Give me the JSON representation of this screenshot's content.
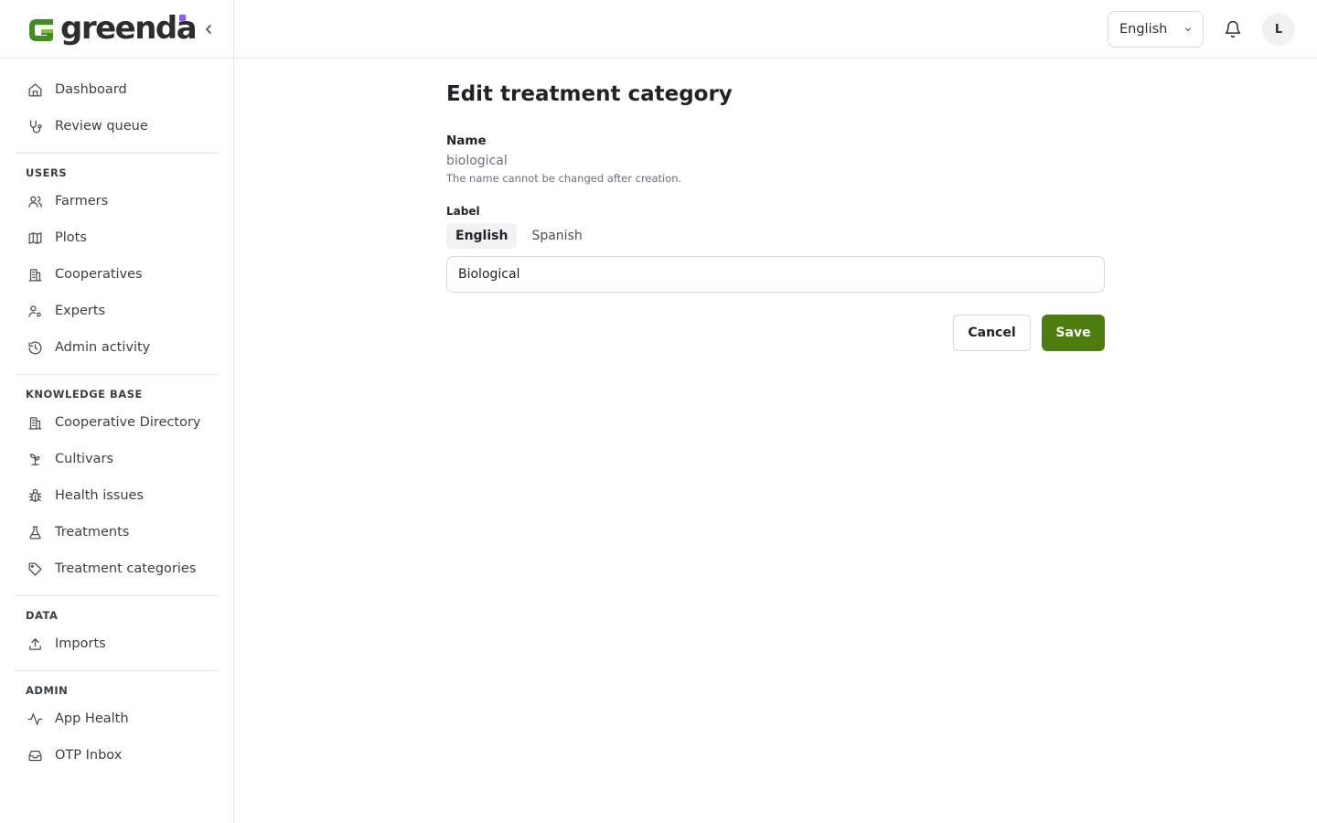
{
  "brand": {
    "name": "greenda",
    "accent": "#8b5cf6",
    "logo_green": "#3f8f1f"
  },
  "sidebar": {
    "main": [
      {
        "label": "Dashboard",
        "icon": "home-icon"
      },
      {
        "label": "Review queue",
        "icon": "stethoscope-icon"
      }
    ],
    "users_title": "USERS",
    "users": [
      {
        "label": "Farmers",
        "icon": "users-icon"
      },
      {
        "label": "Plots",
        "icon": "map-icon"
      },
      {
        "label": "Cooperatives",
        "icon": "building-icon"
      },
      {
        "label": "Experts",
        "icon": "user-cog-icon"
      },
      {
        "label": "Admin activity",
        "icon": "history-icon"
      }
    ],
    "kb_title": "KNOWLEDGE BASE",
    "kb": [
      {
        "label": "Cooperative Directory",
        "icon": "building-icon"
      },
      {
        "label": "Cultivars",
        "icon": "sprout-icon"
      },
      {
        "label": "Health issues",
        "icon": "bug-icon"
      },
      {
        "label": "Treatments",
        "icon": "flask-icon"
      },
      {
        "label": "Treatment categories",
        "icon": "tag-icon"
      }
    ],
    "data_title": "DATA",
    "data": [
      {
        "label": "Imports",
        "icon": "upload-icon"
      }
    ],
    "admin_title": "ADMIN",
    "admin": [
      {
        "label": "App Health",
        "icon": "activity-icon"
      },
      {
        "label": "OTP Inbox",
        "icon": "inbox-icon"
      }
    ]
  },
  "header": {
    "language": "English",
    "avatar_initial": "L"
  },
  "form": {
    "title": "Edit treatment category",
    "name_label": "Name",
    "name_value": "biological",
    "name_help": "The name cannot be changed after creation.",
    "label_label": "Label",
    "tabs": [
      {
        "label": "English",
        "active": true
      },
      {
        "label": "Spanish",
        "active": false
      }
    ],
    "label_value": "Biological",
    "cancel_label": "Cancel",
    "save_label": "Save",
    "save_color": "#4d7c0f"
  }
}
